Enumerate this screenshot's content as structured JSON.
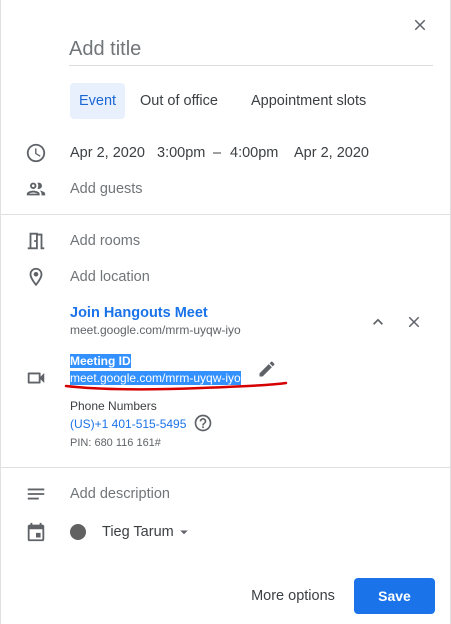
{
  "title": {
    "placeholder": "Add title"
  },
  "tabs": [
    {
      "label": "Event",
      "active": true
    },
    {
      "label": "Out of office",
      "active": false
    },
    {
      "label": "Appointment slots",
      "active": false
    }
  ],
  "datetime": {
    "start_date": "Apr 2, 2020",
    "start_time": "3:00pm",
    "separator": "–",
    "end_time": "4:00pm",
    "end_date": "Apr 2, 2020"
  },
  "guests": {
    "placeholder": "Add guests"
  },
  "rooms": {
    "placeholder": "Add rooms"
  },
  "location": {
    "placeholder": "Add location"
  },
  "conference": {
    "join_label": "Join Hangouts Meet",
    "join_url": "meet.google.com/mrm-uyqw-iyo",
    "meeting_id_label": "Meeting ID",
    "meeting_id_value": "meet.google.com/mrm-uyqw-iyo",
    "phone_label": "Phone Numbers",
    "phone_number": "(US)+1 401-515-5495",
    "pin": "PIN: 680 116 161#"
  },
  "description": {
    "placeholder": "Add description"
  },
  "calendar": {
    "owner": "Tieg Tarum",
    "color": "#616161"
  },
  "footer": {
    "more_options": "More options",
    "save": "Save"
  },
  "colors": {
    "accent": "#1a73e8",
    "annotation": "#d50000"
  }
}
